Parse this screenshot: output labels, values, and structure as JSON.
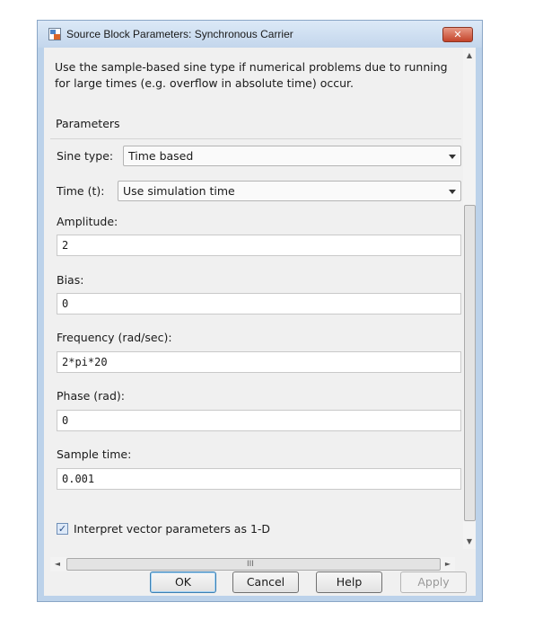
{
  "window": {
    "title": "Source Block Parameters: Synchronous Carrier",
    "close_label": "✕"
  },
  "description": {
    "line1": "Use the sample-based sine type if numerical problems due to running",
    "line2": "for large times (e.g. overflow in absolute time) occur."
  },
  "parameters": {
    "group_title": "Parameters",
    "sine_type": {
      "label": "Sine type:",
      "value": "Time based"
    },
    "time": {
      "label": "Time (t):",
      "value": "Use simulation time"
    },
    "amplitude": {
      "label": "Amplitude:",
      "value": "2"
    },
    "bias": {
      "label": "Bias:",
      "value": "0"
    },
    "frequency": {
      "label": "Frequency (rad/sec):",
      "value": "2*pi*20"
    },
    "phase": {
      "label": "Phase (rad):",
      "value": "0"
    },
    "sample_time": {
      "label": "Sample time:",
      "value": "0.001"
    },
    "interpret_vector": {
      "label": "Interpret vector parameters as 1-D",
      "checked": true,
      "mark": "✓"
    }
  },
  "scrollbars": {
    "up": "▲",
    "down": "▼",
    "left": "◄",
    "right": "►",
    "h_grip": "III"
  },
  "buttons": {
    "ok": "OK",
    "cancel": "Cancel",
    "help": "Help",
    "apply": "Apply"
  }
}
